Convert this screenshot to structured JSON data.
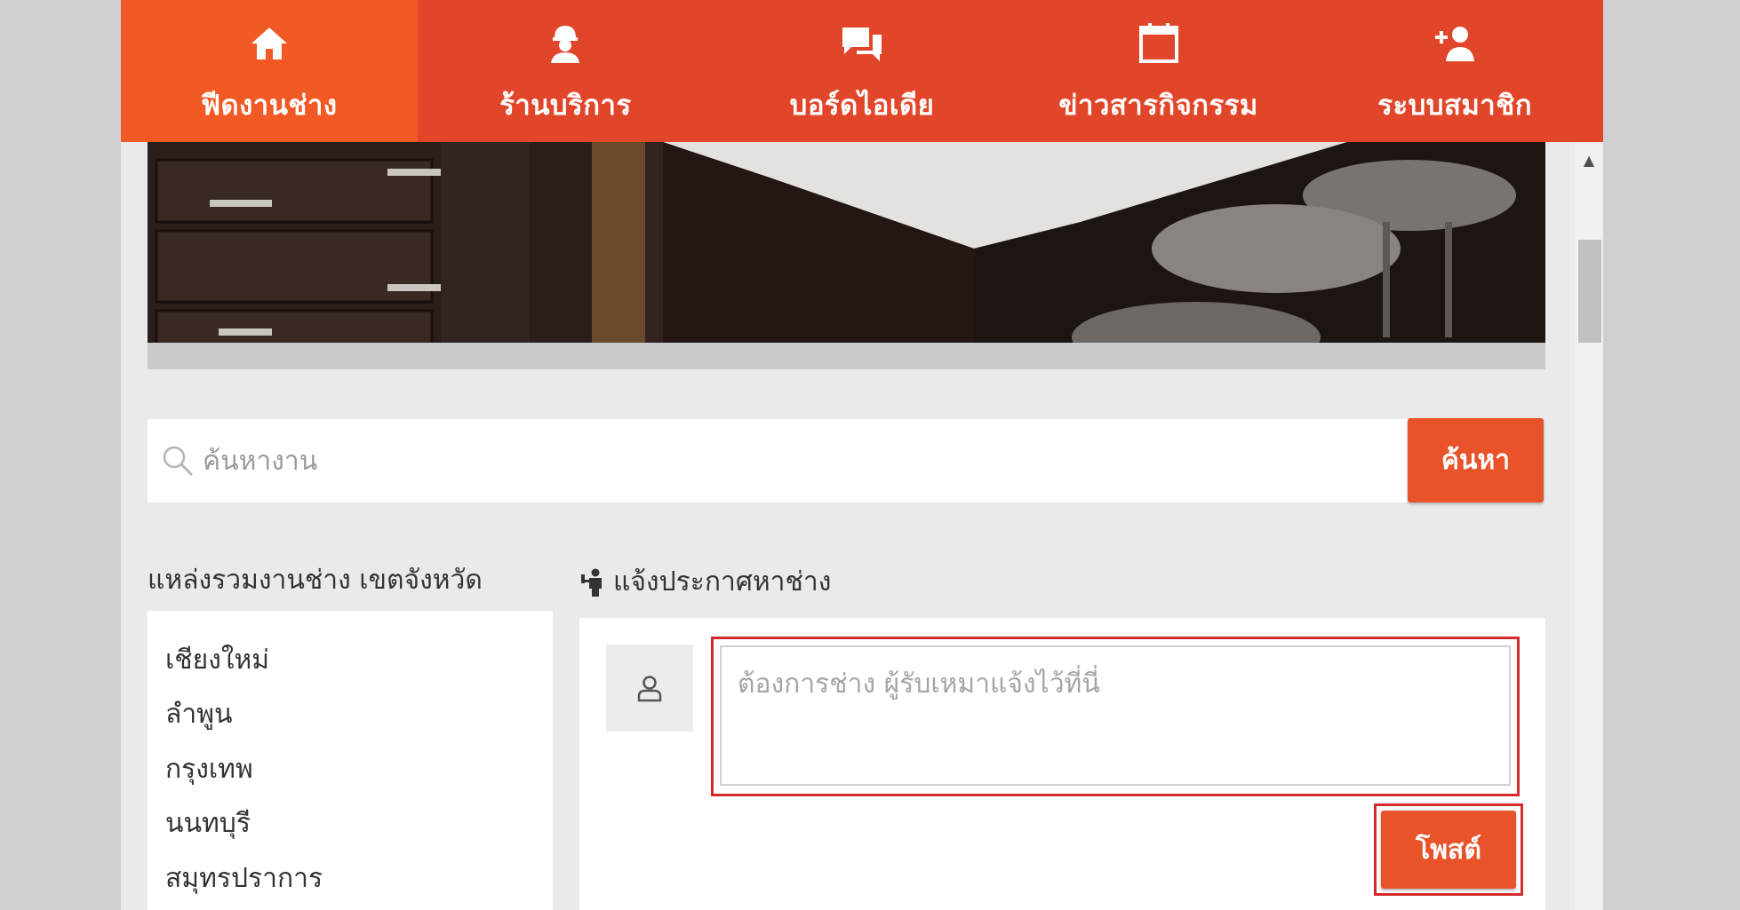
{
  "nav": {
    "items": [
      {
        "label": "ฟีดงานช่าง",
        "icon": "home-icon",
        "active": true
      },
      {
        "label": "ร้านบริการ",
        "icon": "worker-icon",
        "active": false
      },
      {
        "label": "บอร์ดไอเดีย",
        "icon": "chat-icon",
        "active": false
      },
      {
        "label": "ข่าวสารกิจกรรม",
        "icon": "calendar-icon",
        "active": false
      },
      {
        "label": "ระบบสมาชิก",
        "icon": "add-user-icon",
        "active": false
      }
    ],
    "color": "#e2462a",
    "active_color": "#f15a24"
  },
  "hero": {
    "icon": "kitchen-photo"
  },
  "search": {
    "placeholder": "ค้นหางาน",
    "button_label": "ค้นหา"
  },
  "provinces": {
    "heading": "แหล่งรวมงานช่าง เขตจังหวัด",
    "items": [
      "เชียงใหม่",
      "ลำพูน",
      "กรุงเทพ",
      "นนทบุรี",
      "สมุทรปราการ"
    ]
  },
  "post": {
    "heading": "แจ้งประกาศหาช่าง",
    "placeholder": "ต้องการช่าง ผู้รับเหมาแจ้งไว้ที่นี่",
    "button_label": "โพสต์",
    "accent": "#e8532a",
    "highlight_color": "#d42a2a"
  }
}
